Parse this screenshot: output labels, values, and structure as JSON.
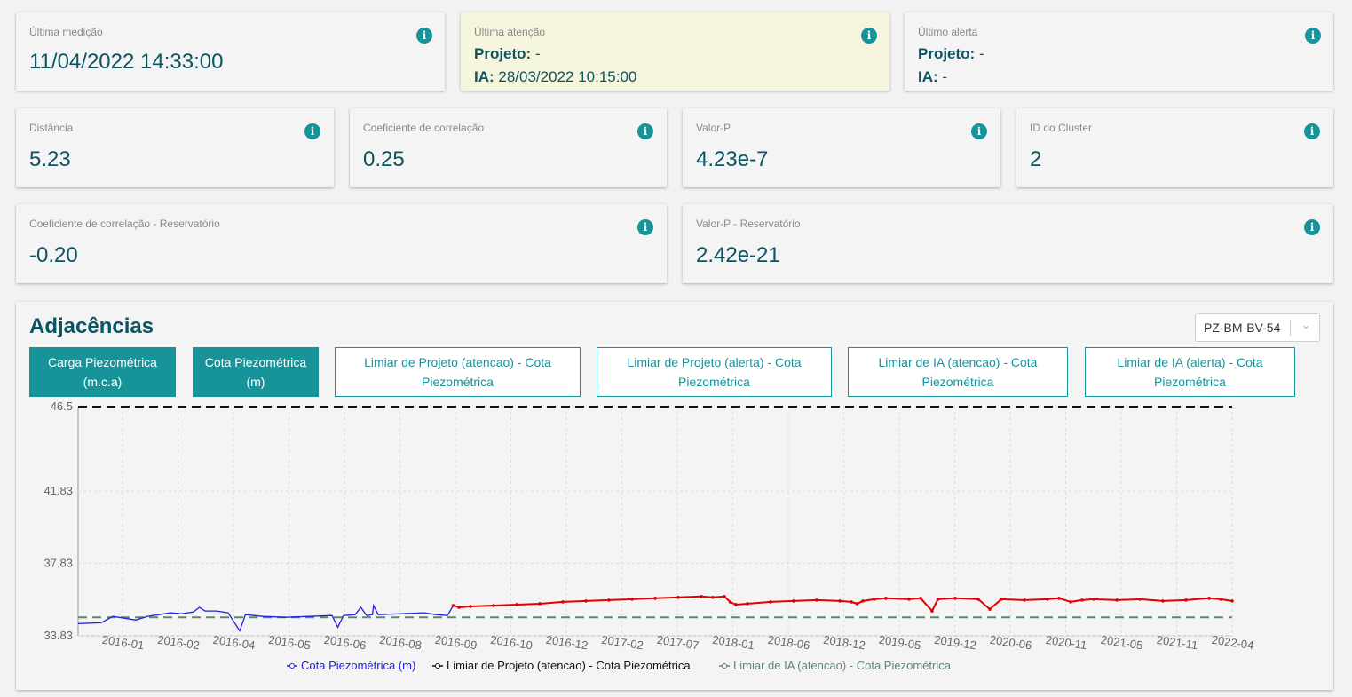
{
  "summary": {
    "last_measurement": {
      "label": "Última medição",
      "value": "11/04/2022 14:33:00"
    },
    "last_attention": {
      "label": "Última atenção",
      "project_key": "Projeto:",
      "project_value": " -",
      "ia_key": "IA:",
      "ia_value": " 28/03/2022 10:15:00"
    },
    "last_alert": {
      "label": "Último alerta",
      "project_key": "Projeto:",
      "project_value": " -",
      "ia_key": "IA:",
      "ia_value": " -"
    }
  },
  "metrics": {
    "distance": {
      "label": "Distância",
      "value": "5.23"
    },
    "correlation": {
      "label": "Coeficiente de correlação",
      "value": "0.25"
    },
    "p_value": {
      "label": "Valor-P",
      "value": "4.23e-7"
    },
    "cluster_id": {
      "label": "ID do Cluster",
      "value": "2"
    },
    "correlation_reservoir": {
      "label": "Coeficiente de correlação - Reservatório",
      "value": "-0.20"
    },
    "p_value_reservoir": {
      "label": "Valor-P - Reservatório",
      "value": "2.42e-21"
    }
  },
  "icons": {
    "info": "info-icon",
    "dropdown": "chevron-down-icon"
  },
  "adjacencias": {
    "title": "Adjacências",
    "instrument_select": "PZ-BM-BV-54",
    "toggles": [
      {
        "line1": "Carga Piezométrica",
        "line2": "(m.c.a)",
        "active": true
      },
      {
        "line1": "Cota Piezométrica",
        "line2": "(m)",
        "active": true
      },
      {
        "line1": "Limiar de Projeto (atencao) - Cota",
        "line2": "Piezométrica",
        "active": false
      },
      {
        "line1": "Limiar de Projeto (alerta) - Cota",
        "line2": "Piezométrica",
        "active": false
      },
      {
        "line1": "Limiar de IA (atencao) - Cota",
        "line2": "Piezométrica",
        "active": false
      },
      {
        "line1": "Limiar de IA (alerta) - Cota",
        "line2": "Piezométrica",
        "active": false
      }
    ]
  },
  "colors": {
    "accent": "#17939a",
    "text_dark": "#0b5563",
    "highlight_bg": "#f5f4dc",
    "series_blue": "#2222dd",
    "series_red": "#e00000",
    "threshold_black": "#111111",
    "threshold_green": "#5a8a6a"
  },
  "chart_data": {
    "type": "line",
    "y_ticks": [
      "46.5",
      "41.83",
      "37.83",
      "33.83"
    ],
    "ylim": [
      33.83,
      46.5
    ],
    "x_ticks": [
      "2016-01",
      "2016-02",
      "2016-04",
      "2016-05",
      "2016-06",
      "2016-08",
      "2016-09",
      "2016-10",
      "2016-12",
      "2017-02",
      "2017-07",
      "2018-01",
      "2018-06",
      "2018-12",
      "2019-05",
      "2019-12",
      "2020-06",
      "2020-11",
      "2021-05",
      "2021-11",
      "2022-04"
    ],
    "grid": true,
    "legend_position": "bottom",
    "series": [
      {
        "name": "Cota Piezométrica (m)",
        "color": "#2222dd"
      },
      {
        "name": "Limiar de Projeto (atencao) - Cota Piezométrica",
        "color": "#111111",
        "value": 46.5
      },
      {
        "name": "Limiar de IA (atencao) - Cota Piezométrica",
        "color": "#5a8a6a",
        "value": 34.85
      }
    ],
    "cota_points": [
      [
        0,
        34.5
      ],
      [
        0.02,
        34.55
      ],
      [
        0.03,
        34.9
      ],
      [
        0.04,
        34.8
      ],
      [
        0.05,
        34.7
      ],
      [
        0.06,
        34.9
      ],
      [
        0.07,
        35.0
      ],
      [
        0.08,
        35.1
      ],
      [
        0.09,
        35.05
      ],
      [
        0.1,
        35.15
      ],
      [
        0.105,
        35.4
      ],
      [
        0.11,
        35.2
      ],
      [
        0.12,
        35.2
      ],
      [
        0.13,
        35.1
      ],
      [
        0.14,
        34.1
      ],
      [
        0.145,
        35.0
      ],
      [
        0.16,
        34.9
      ],
      [
        0.18,
        34.85
      ],
      [
        0.2,
        34.9
      ],
      [
        0.22,
        34.95
      ],
      [
        0.225,
        34.3
      ],
      [
        0.23,
        34.95
      ],
      [
        0.24,
        35.0
      ],
      [
        0.245,
        35.4
      ],
      [
        0.25,
        34.95
      ],
      [
        0.26,
        35.0
      ],
      [
        0.255,
        35.0
      ],
      [
        0.256,
        35.5
      ],
      [
        0.26,
        35.0
      ],
      [
        0.28,
        35.05
      ],
      [
        0.3,
        35.1
      ],
      [
        0.31,
        35.0
      ],
      [
        0.32,
        34.95
      ],
      [
        0.325,
        35.5
      ],
      [
        0.33,
        35.4
      ],
      [
        0.34,
        35.45
      ],
      [
        0.36,
        35.5
      ],
      [
        0.38,
        35.55
      ],
      [
        0.4,
        35.6
      ],
      [
        0.42,
        35.7
      ],
      [
        0.44,
        35.75
      ],
      [
        0.46,
        35.8
      ],
      [
        0.48,
        35.85
      ],
      [
        0.5,
        35.9
      ],
      [
        0.52,
        35.95
      ],
      [
        0.54,
        36.0
      ],
      [
        0.55,
        35.95
      ],
      [
        0.56,
        36.0
      ],
      [
        0.565,
        35.7
      ],
      [
        0.57,
        35.55
      ],
      [
        0.58,
        35.6
      ],
      [
        0.6,
        35.7
      ],
      [
        0.62,
        35.75
      ],
      [
        0.64,
        35.8
      ],
      [
        0.66,
        35.75
      ],
      [
        0.67,
        35.7
      ],
      [
        0.675,
        35.6
      ],
      [
        0.68,
        35.75
      ],
      [
        0.69,
        35.85
      ],
      [
        0.7,
        35.9
      ],
      [
        0.72,
        35.85
      ],
      [
        0.73,
        35.9
      ],
      [
        0.74,
        35.2
      ],
      [
        0.745,
        35.85
      ],
      [
        0.76,
        35.9
      ],
      [
        0.78,
        35.85
      ],
      [
        0.79,
        35.3
      ],
      [
        0.8,
        35.85
      ],
      [
        0.82,
        35.8
      ],
      [
        0.84,
        35.85
      ],
      [
        0.85,
        35.9
      ],
      [
        0.86,
        35.7
      ],
      [
        0.87,
        35.8
      ],
      [
        0.88,
        35.85
      ],
      [
        0.9,
        35.8
      ],
      [
        0.92,
        35.85
      ],
      [
        0.94,
        35.75
      ],
      [
        0.96,
        35.8
      ],
      [
        0.98,
        35.9
      ],
      [
        0.99,
        35.85
      ],
      [
        1.0,
        35.75
      ]
    ]
  }
}
